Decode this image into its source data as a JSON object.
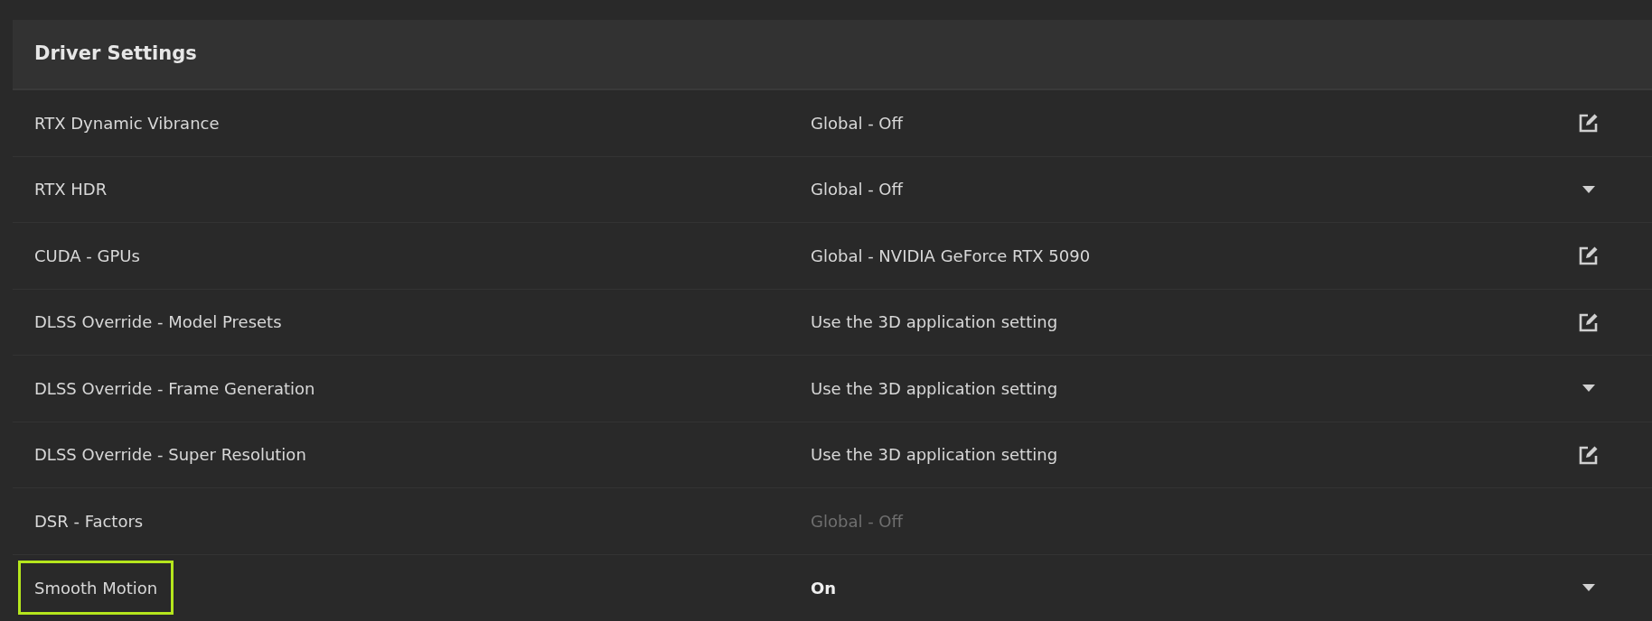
{
  "section": {
    "title": "Driver Settings"
  },
  "rows": [
    {
      "label": "RTX Dynamic Vibrance",
      "value": "Global - Off",
      "kind": "edit",
      "disabled": false,
      "modified": false,
      "highlighted": false
    },
    {
      "label": "RTX HDR",
      "value": "Global - Off",
      "kind": "dropdown",
      "disabled": false,
      "modified": false,
      "highlighted": false
    },
    {
      "label": "CUDA - GPUs",
      "value": "Global - NVIDIA GeForce RTX 5090",
      "kind": "edit",
      "disabled": false,
      "modified": false,
      "highlighted": false
    },
    {
      "label": "DLSS Override - Model Presets",
      "value": "Use the 3D application setting",
      "kind": "edit",
      "disabled": false,
      "modified": false,
      "highlighted": false
    },
    {
      "label": "DLSS Override - Frame Generation",
      "value": "Use the 3D application setting",
      "kind": "dropdown",
      "disabled": false,
      "modified": false,
      "highlighted": false
    },
    {
      "label": "DLSS Override - Super Resolution",
      "value": "Use the 3D application setting",
      "kind": "edit",
      "disabled": false,
      "modified": false,
      "highlighted": false
    },
    {
      "label": "DSR - Factors",
      "value": "Global - Off",
      "kind": "none",
      "disabled": true,
      "modified": false,
      "highlighted": false
    },
    {
      "label": "Smooth Motion",
      "value": "On",
      "kind": "dropdown",
      "disabled": false,
      "modified": true,
      "highlighted": true
    }
  ]
}
